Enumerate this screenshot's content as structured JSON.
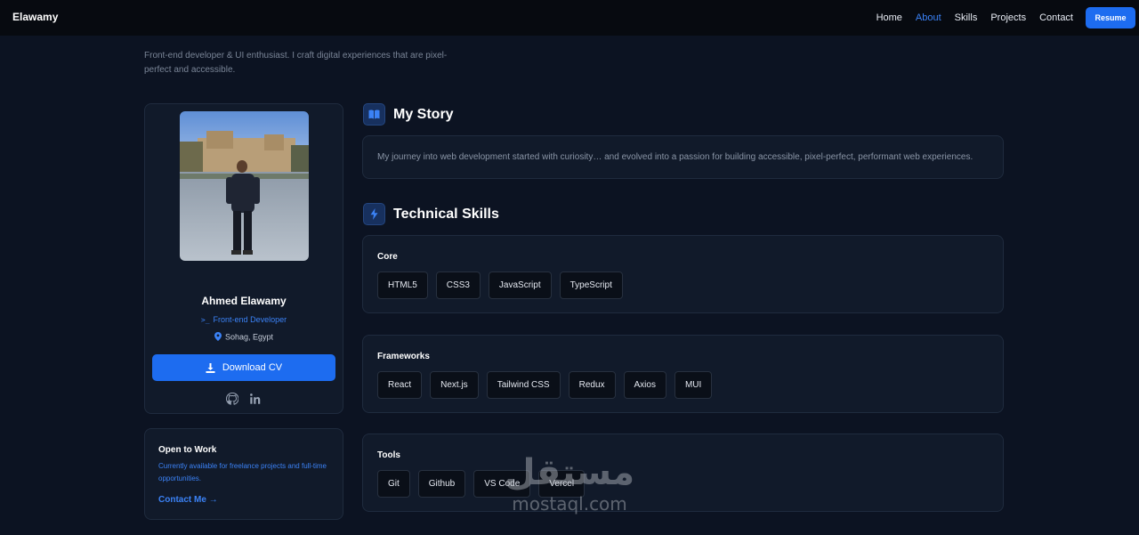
{
  "nav": {
    "brand": "Elawamy",
    "links": [
      "Home",
      "About",
      "Skills",
      "Projects",
      "Contact"
    ],
    "active": "About",
    "resume": "Resume"
  },
  "intro": "Front-end developer & UI enthusiast. I craft digital experiences that are pixel-perfect and accessible.",
  "profile": {
    "name": "Ahmed Elawamy",
    "role": "Front-end Developer",
    "location": "Sohag, Egypt",
    "download": "Download CV",
    "socials": [
      "github-icon",
      "linkedin-icon"
    ]
  },
  "work": {
    "title": "Open to Work",
    "text": "Currently available for freelance projects and full-time opportunities.",
    "link": "Contact Me",
    "link_arrow": "→"
  },
  "story": {
    "heading": "My Story",
    "text": "My journey into web development started with curiosity… and evolved into a passion for building accessible, pixel-perfect, performant web experiences."
  },
  "skills": {
    "heading": "Technical Skills",
    "groups": [
      {
        "title": "Core",
        "items": [
          "HTML5",
          "CSS3",
          "JavaScript",
          "TypeScript"
        ]
      },
      {
        "title": "Frameworks",
        "items": [
          "React",
          "Next.js",
          "Tailwind CSS",
          "Redux",
          "Axios",
          "MUI"
        ]
      },
      {
        "title": "Tools",
        "items": [
          "Git",
          "Github",
          "VS Code",
          "Vercel"
        ]
      }
    ]
  },
  "watermark": {
    "arabic": "مستقل",
    "latin": "mostaql.com"
  },
  "colors": {
    "accent": "#1d6cf0",
    "link": "#3b82f6",
    "background": "#0c1322",
    "card": "#111a2a"
  }
}
